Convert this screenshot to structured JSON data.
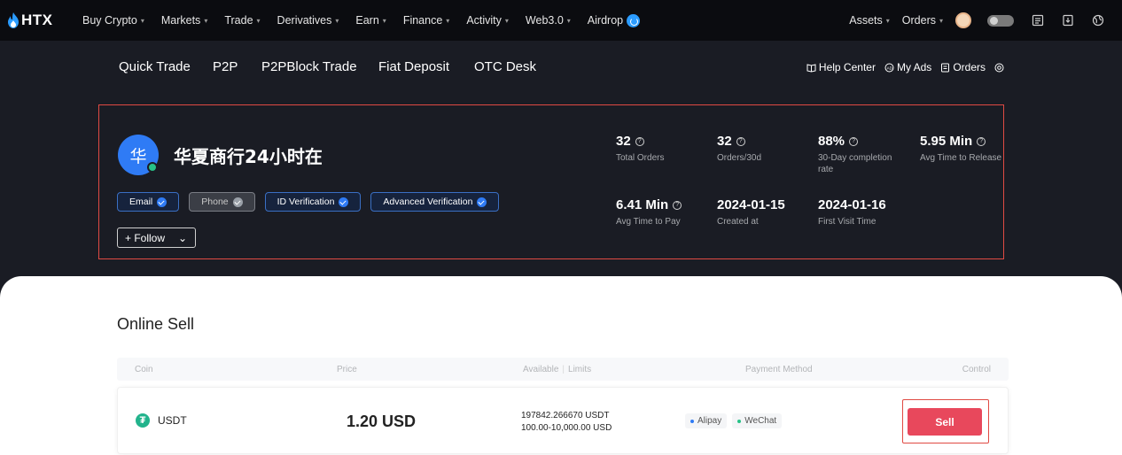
{
  "app": {
    "logo_text": "HTX"
  },
  "topnav": {
    "items": [
      {
        "label": "Buy Crypto",
        "caret": "▾"
      },
      {
        "label": "Markets",
        "caret": "▾"
      },
      {
        "label": "Trade",
        "caret": "▾"
      },
      {
        "label": "Derivatives",
        "caret": "▾"
      },
      {
        "label": "Earn",
        "caret": "▾"
      },
      {
        "label": "Finance",
        "caret": "▾"
      },
      {
        "label": "Activity",
        "caret": "▾"
      },
      {
        "label": "Web3.0",
        "caret": "▾"
      },
      {
        "label": "Airdrop"
      }
    ],
    "right": {
      "assets": "Assets",
      "orders": "Orders",
      "caret": "▾"
    }
  },
  "subnav": {
    "items": [
      "Quick Trade",
      "P2P",
      "P2PBlock Trade",
      "Fiat Deposit",
      "OTC Desk"
    ],
    "right": {
      "help": "Help Center",
      "my_ads": "My Ads",
      "orders": "Orders"
    }
  },
  "merchant": {
    "avatar_char": "华",
    "name": "华夏商行24小时在",
    "badges": [
      {
        "label": "Email",
        "verified": true
      },
      {
        "label": "Phone",
        "verified": false
      },
      {
        "label": "ID Verification",
        "verified": true
      },
      {
        "label": "Advanced Verification",
        "verified": true
      }
    ],
    "follow_label": "+ Follow",
    "follow_caret": "⌄",
    "stats": [
      {
        "value": "32",
        "label": "Total Orders"
      },
      {
        "value": "32",
        "label": "Orders/30d"
      },
      {
        "value": "88%",
        "label": "30-Day completion rate"
      },
      {
        "value": "5.95 Min",
        "label": "Avg Time to Release"
      },
      {
        "value": "6.41 Min",
        "label": "Avg Time to Pay"
      },
      {
        "value": "2024-01-15",
        "label": "Created at"
      },
      {
        "value": "2024-01-16",
        "label": "First Visit Time"
      }
    ]
  },
  "online_sell": {
    "title": "Online Sell",
    "columns": {
      "coin": "Coin",
      "price": "Price",
      "available": "Available",
      "limits": "Limits",
      "payment": "Payment Method",
      "control": "Control"
    },
    "rows": [
      {
        "coin": "USDT",
        "price": "1.20 USD",
        "available": "197842.266670 USDT",
        "limits": "100.00-10,000.00 USD",
        "payments": [
          {
            "label": "Alipay",
            "color": "#2f7bf5"
          },
          {
            "label": "WeChat",
            "color": "#27c287"
          }
        ],
        "action": "Sell"
      }
    ]
  },
  "colors": {
    "accent_blue": "#2f7bf5",
    "sell_red": "#e8485c",
    "highlight_red": "#e04a43",
    "online_green": "#27c287",
    "tether_green": "#22b38c"
  }
}
